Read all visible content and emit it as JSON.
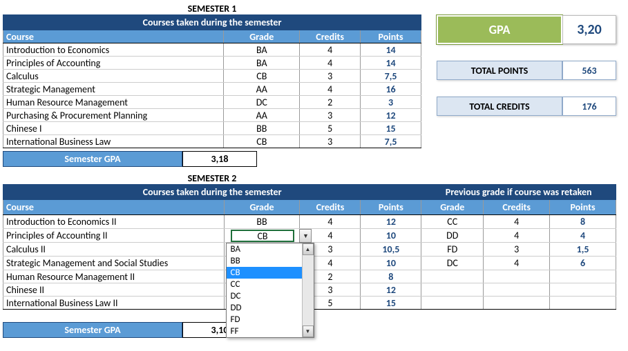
{
  "sem1": {
    "title": "SEMESTER 1",
    "table_title": "Courses taken during the semester",
    "cols": {
      "course": "Course",
      "grade": "Grade",
      "credits": "Credits",
      "points": "Points"
    },
    "rows": [
      {
        "course": "Introduction to Economics",
        "grade": "BA",
        "credits": "4",
        "points": "14"
      },
      {
        "course": "Principles of Accounting",
        "grade": "BA",
        "credits": "4",
        "points": "14"
      },
      {
        "course": "Calculus",
        "grade": "CB",
        "credits": "3",
        "points": "7,5"
      },
      {
        "course": "Strategic Management",
        "grade": "AA",
        "credits": "4",
        "points": "16"
      },
      {
        "course": "Human Resource Management",
        "grade": "DC",
        "credits": "2",
        "points": "3"
      },
      {
        "course": "Purchasing & Procurement Planning",
        "grade": "AA",
        "credits": "3",
        "points": "12"
      },
      {
        "course": "Chinese I",
        "grade": "BB",
        "credits": "5",
        "points": "15"
      },
      {
        "course": "International Business Law",
        "grade": "CB",
        "credits": "3",
        "points": "7,5"
      }
    ],
    "gpa_label": "Semester GPA",
    "gpa_value": "3,18"
  },
  "sem2": {
    "title": "SEMESTER 2",
    "table_title": "Courses taken during the semester",
    "prev_title": "Previous grade if course was retaken",
    "cols": {
      "course": "Course",
      "grade": "Grade",
      "credits": "Credits",
      "points": "Points"
    },
    "rows": [
      {
        "course": "Introduction to Economics II",
        "grade": "BB",
        "credits": "4",
        "points": "12",
        "pg": "CC",
        "pc": "4",
        "pp": "8"
      },
      {
        "course": "Principles of Accounting II",
        "grade": "CB",
        "credits": "4",
        "points": "10",
        "pg": "DD",
        "pc": "4",
        "pp": "4"
      },
      {
        "course": "Calculus II",
        "grade": "",
        "credits": "3",
        "points": "10,5",
        "pg": "FD",
        "pc": "3",
        "pp": "1,5"
      },
      {
        "course": "Strategic Management and Social Studies",
        "grade": "",
        "credits": "4",
        "points": "10",
        "pg": "DC",
        "pc": "4",
        "pp": "6"
      },
      {
        "course": "Human Resource Management II",
        "grade": "",
        "credits": "2",
        "points": "8",
        "pg": "",
        "pc": "",
        "pp": ""
      },
      {
        "course": "Chinese II",
        "grade": "",
        "credits": "3",
        "points": "12",
        "pg": "",
        "pc": "",
        "pp": ""
      },
      {
        "course": "International Business Law II",
        "grade": "",
        "credits": "5",
        "points": "15",
        "pg": "",
        "pc": "",
        "pp": ""
      }
    ],
    "gpa_label": "Semester GPA",
    "gpa_value": "3,10"
  },
  "dropdown": {
    "selected": "CB",
    "options": [
      "BA",
      "BB",
      "CB",
      "CC",
      "DC",
      "DD",
      "FD",
      "FF"
    ]
  },
  "summary": {
    "gpa_label": "GPA",
    "gpa_value": "3,20",
    "points_label": "TOTAL POINTS",
    "points_value": "563",
    "credits_label": "TOTAL CREDITS",
    "credits_value": "176"
  },
  "chart_data": {
    "type": "table",
    "tables": [
      {
        "title": "SEMESTER 1",
        "columns": [
          "Course",
          "Grade",
          "Credits",
          "Points"
        ],
        "rows": [
          [
            "Introduction to Economics",
            "BA",
            4,
            14
          ],
          [
            "Principles of Accounting",
            "BA",
            4,
            14
          ],
          [
            "Calculus",
            "CB",
            3,
            7.5
          ],
          [
            "Strategic Management",
            "AA",
            4,
            16
          ],
          [
            "Human Resource Management",
            "DC",
            2,
            3
          ],
          [
            "Purchasing & Procurement Planning",
            "AA",
            3,
            12
          ],
          [
            "Chinese I",
            "BB",
            5,
            15
          ],
          [
            "International Business Law",
            "CB",
            3,
            7.5
          ]
        ],
        "semester_gpa": 3.18
      },
      {
        "title": "SEMESTER 2",
        "columns": [
          "Course",
          "Grade",
          "Credits",
          "Points",
          "PrevGrade",
          "PrevCredits",
          "PrevPoints"
        ],
        "rows": [
          [
            "Introduction to Economics II",
            "BB",
            4,
            12,
            "CC",
            4,
            8
          ],
          [
            "Principles of Accounting II",
            "CB",
            4,
            10,
            "DD",
            4,
            4
          ],
          [
            "Calculus II",
            null,
            3,
            10.5,
            "FD",
            3,
            1.5
          ],
          [
            "Strategic Management and Social Studies",
            null,
            4,
            10,
            "DC",
            4,
            6
          ],
          [
            "Human Resource Management II",
            null,
            2,
            8,
            null,
            null,
            null
          ],
          [
            "Chinese II",
            null,
            3,
            12,
            null,
            null,
            null
          ],
          [
            "International Business Law II",
            null,
            5,
            15,
            null,
            null,
            null
          ]
        ],
        "semester_gpa": 3.1
      }
    ],
    "summary": {
      "GPA": 3.2,
      "TOTAL POINTS": 563,
      "TOTAL CREDITS": 176
    }
  }
}
